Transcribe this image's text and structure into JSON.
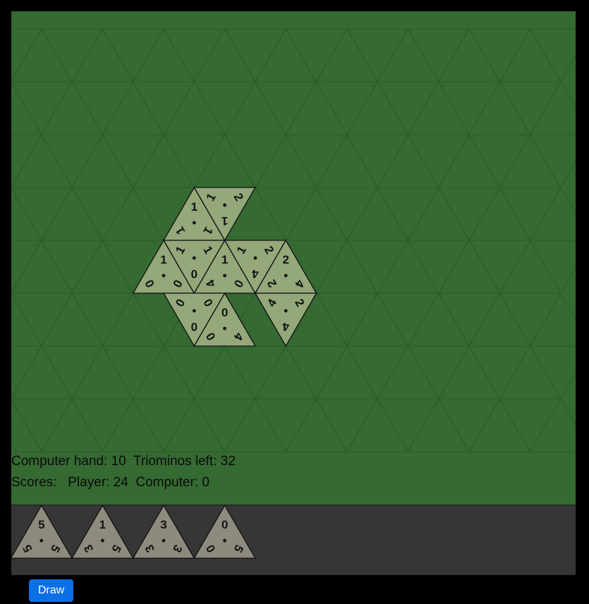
{
  "board": {
    "background_color": "#356a32",
    "grid_line_color": "#2b5a29",
    "placed_tile_color": "#94a87a",
    "tiles": [
      {
        "col": 5,
        "row": 3,
        "up": true,
        "values": [
          "1",
          "1",
          "1"
        ]
      },
      {
        "col": 6,
        "row": 3,
        "up": false,
        "values": [
          "1",
          "2",
          "1"
        ]
      },
      {
        "col": 4,
        "row": 4,
        "up": true,
        "values": [
          "1",
          "0",
          "0"
        ]
      },
      {
        "col": 5,
        "row": 4,
        "up": false,
        "values": [
          "1",
          "1",
          "0"
        ]
      },
      {
        "col": 6,
        "row": 4,
        "up": true,
        "values": [
          "1",
          "0",
          "4"
        ]
      },
      {
        "col": 7,
        "row": 4,
        "up": false,
        "values": [
          "1",
          "2",
          "4"
        ]
      },
      {
        "col": 8,
        "row": 4,
        "up": true,
        "values": [
          "2",
          "4",
          "2"
        ]
      },
      {
        "col": 5,
        "row": 5,
        "up": false,
        "values": [
          "0",
          "0",
          "0"
        ]
      },
      {
        "col": 6,
        "row": 5,
        "up": true,
        "values": [
          "0",
          "4",
          "0"
        ]
      },
      {
        "col": 8,
        "row": 5,
        "up": false,
        "values": [
          "4",
          "2",
          "4"
        ]
      }
    ]
  },
  "status": {
    "line1": "Computer hand: 10  Triominos left: 32",
    "line2": "Scores:   Player: 24  Computer: 0"
  },
  "hand": {
    "tile_color": "#8f8a7e",
    "tiles": [
      {
        "values": [
          "5",
          "5",
          "5"
        ]
      },
      {
        "values": [
          "1",
          "5",
          "3"
        ]
      },
      {
        "values": [
          "3",
          "3",
          "3"
        ]
      },
      {
        "values": [
          "0",
          "5",
          "0"
        ]
      }
    ]
  },
  "controls": {
    "draw_label": "Draw",
    "draw_color": "#0b6fe6"
  }
}
